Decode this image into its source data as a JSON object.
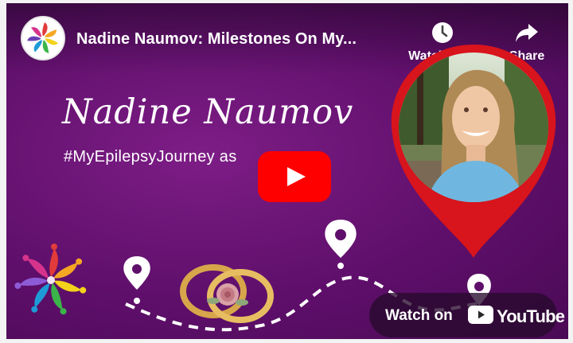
{
  "video": {
    "title": "Nadine Naumov: Milestones On My...",
    "overlay_name": "Nadine Naumov",
    "overlay_hashtag": "#MyEpilepsyJourney as"
  },
  "actions": {
    "watch_later_label": "Watch later",
    "share_label": "Share"
  },
  "watch_on": {
    "prefix": "Watch on",
    "brand": "YouTube"
  },
  "colors": {
    "background_purple": "#5f0f6b",
    "pin_red": "#d8141c",
    "play_red": "#ff0000"
  },
  "icons": {
    "watch_later": "clock-icon",
    "share": "share-arrow-icon",
    "play": "play-icon",
    "location_pin": "map-pin-icon"
  }
}
